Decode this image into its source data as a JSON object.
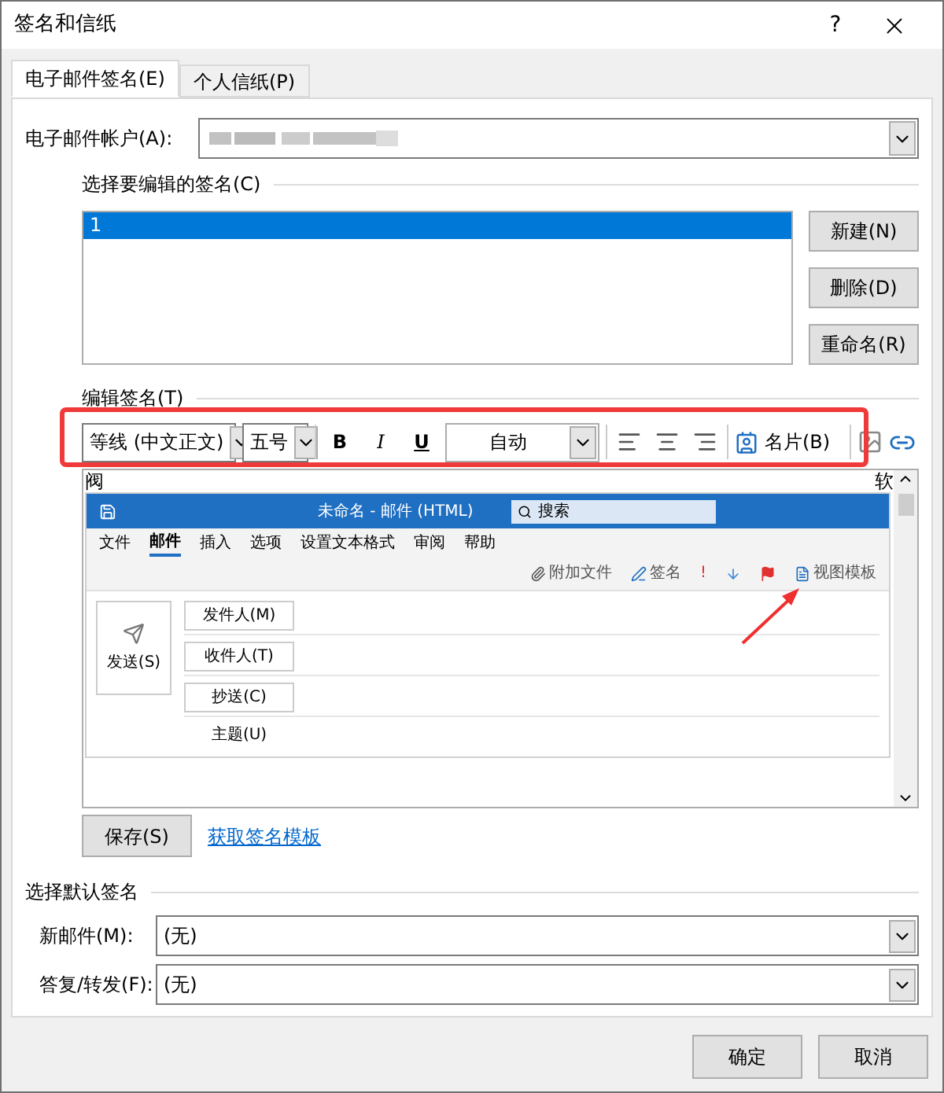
{
  "window": {
    "title": "签名和信纸",
    "help": "?"
  },
  "tabs": [
    {
      "label": "电子邮件签名(E)",
      "selected": true
    },
    {
      "label": "个人信纸(P)",
      "selected": false
    }
  ],
  "account": {
    "label": "电子邮件帐户(A):"
  },
  "signature_list": {
    "label": "选择要编辑的签名(C)",
    "items": [
      {
        "label": "1",
        "selected": true
      }
    ]
  },
  "signature_buttons": [
    "新建(N)",
    "删除(D)",
    "重命名(R)"
  ],
  "editor": {
    "label": "编辑签名(T)",
    "font": "等线 (中文正文)",
    "size": "五号",
    "bold": "B",
    "italic": "I",
    "underline": "U",
    "color_label": "自动",
    "business_card": "名片(B)",
    "text_left": "阀",
    "text_right": "软",
    "screenshot": {
      "title": "未命名 - 邮件 (HTML)",
      "search": "搜索",
      "menu": [
        {
          "label": "文件",
          "selected": false
        },
        {
          "label": "邮件",
          "selected": true
        },
        {
          "label": "插入",
          "selected": false
        },
        {
          "label": "选项",
          "selected": false
        },
        {
          "label": "设置文本格式",
          "selected": false
        },
        {
          "label": "审阅",
          "selected": false
        },
        {
          "label": "帮助",
          "selected": false
        }
      ],
      "toolbar": [
        "附加文件",
        "签名",
        "视图模板"
      ],
      "importance": "!",
      "send": "发送(S)",
      "from": "发件人(M)",
      "to": "收件人(T)",
      "cc": "抄送(C)",
      "subject": "主题(U)"
    }
  },
  "save_button": "保存(S)",
  "template_link": "获取签名模板",
  "defaults": {
    "label": "选择默认签名",
    "fields": [
      {
        "label": "新邮件(M):",
        "value": "(无)"
      },
      {
        "label": "答复/转发(F):",
        "value": "(无)"
      }
    ]
  },
  "buttons": [
    "确定",
    "取消"
  ]
}
